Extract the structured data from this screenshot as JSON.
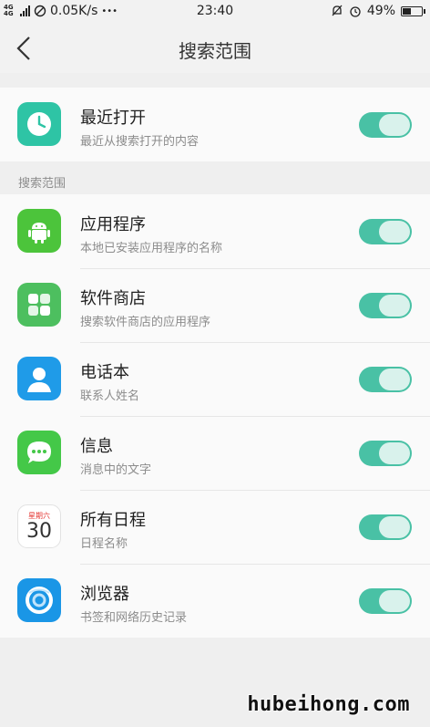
{
  "status_bar": {
    "network": "4G 4G",
    "speed": "0.05K/s",
    "more": "•••",
    "time": "23:40",
    "battery": "49%",
    "battery_level": 0.49
  },
  "header": {
    "title": "搜索范围"
  },
  "recent": {
    "title": "最近打开",
    "subtitle": "最近从搜索打开的内容",
    "enabled": true,
    "icon": "clock-icon",
    "color": "#2ec4a5"
  },
  "section_label": "搜索范围",
  "sources": [
    {
      "title": "应用程序",
      "subtitle": "本地已安装应用程序的名称",
      "enabled": true,
      "icon": "android-icon",
      "color": "#4cc43b"
    },
    {
      "title": "软件商店",
      "subtitle": "搜索软件商店的应用程序",
      "enabled": true,
      "icon": "app-store-icon",
      "color": "#4dbf5f"
    },
    {
      "title": "电话本",
      "subtitle": "联系人姓名",
      "enabled": true,
      "icon": "contact-icon",
      "color": "#1f9be8"
    },
    {
      "title": "信息",
      "subtitle": "消息中的文字",
      "enabled": true,
      "icon": "message-icon",
      "color": "#44c848"
    },
    {
      "title": "所有日程",
      "subtitle": "日程名称",
      "enabled": true,
      "icon": "calendar-icon",
      "color": "#ffffff",
      "icon_text_top": "星期六",
      "icon_text_day": "30"
    },
    {
      "title": "浏览器",
      "subtitle": "书签和网络历史记录",
      "enabled": true,
      "icon": "browser-icon",
      "color": "#1a96e6"
    }
  ],
  "toggle_color": "#49c1a5",
  "watermark": "hubeihong.com"
}
